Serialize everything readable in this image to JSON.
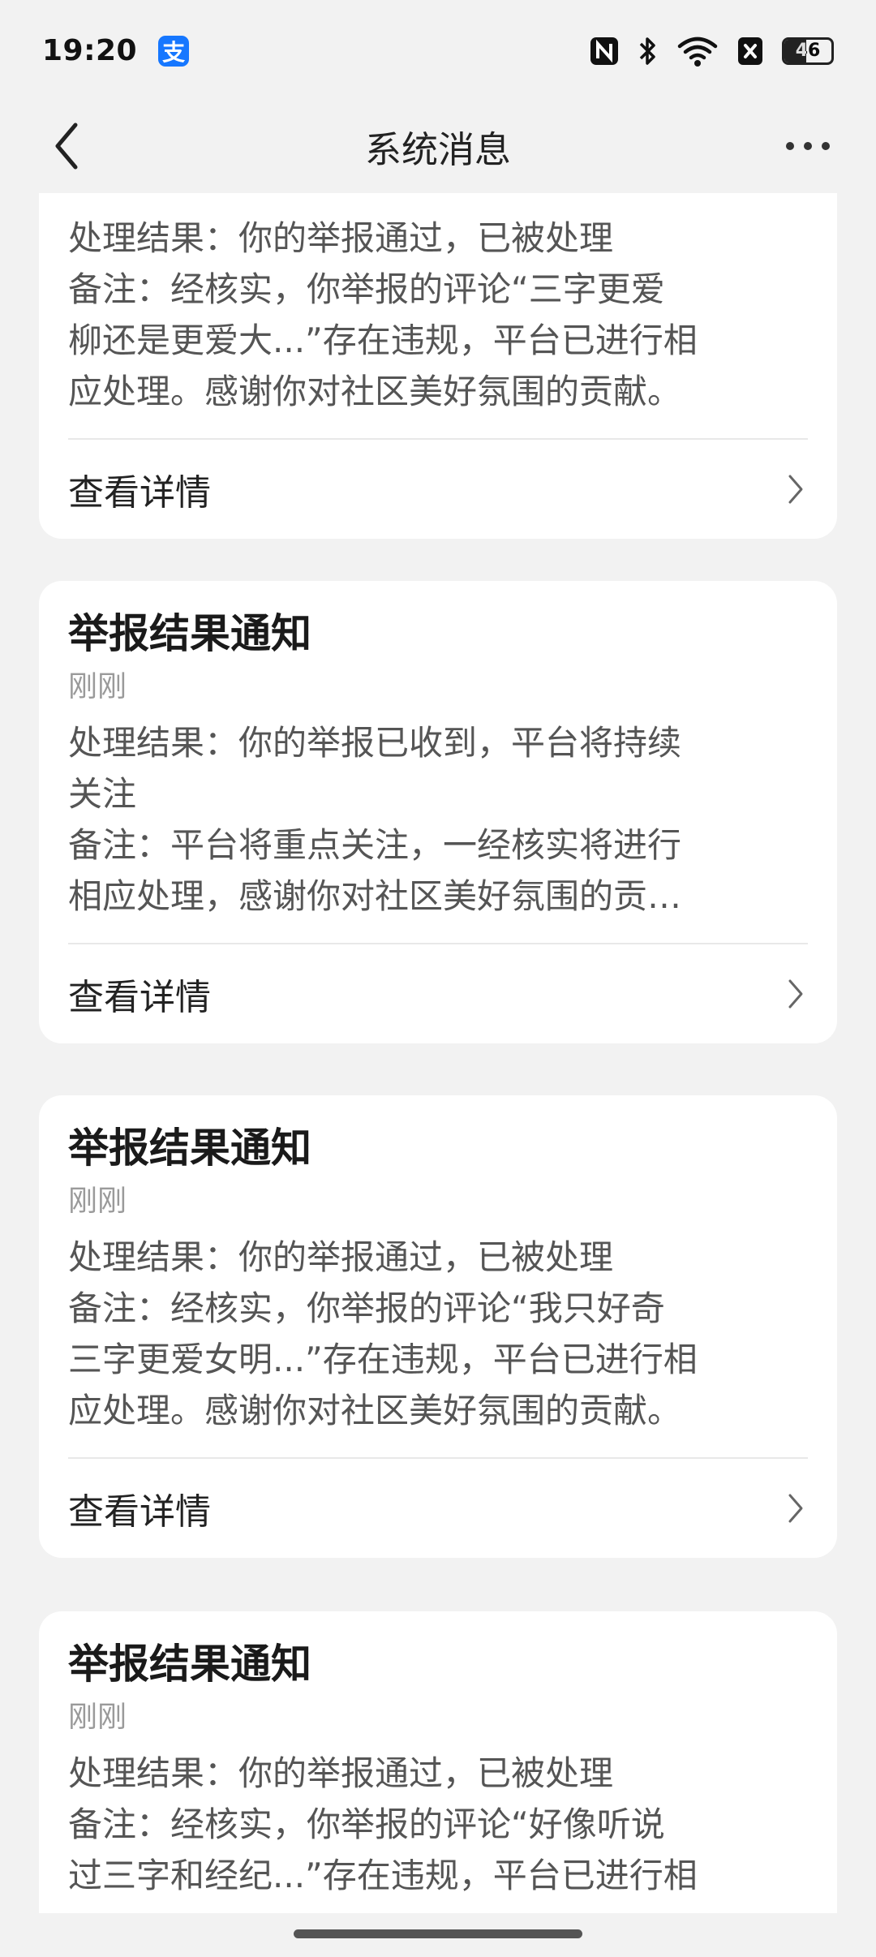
{
  "status_bar": {
    "time": "19:20",
    "app_icon_glyph": "支",
    "battery_level": "46",
    "icons": [
      "alipay-icon",
      "nfc-icon",
      "bluetooth-icon",
      "wifi-icon",
      "sim-icon",
      "battery-icon"
    ]
  },
  "navbar": {
    "title": "系统消息",
    "back_icon": "chevron-left-icon",
    "more_icon": "more-horizontal-icon"
  },
  "cards": [
    {
      "title": "",
      "time": "",
      "body_lines": [
        "处理结果：你的举报通过，已被处理",
        "备注：经核实，你举报的评论“三字更爱",
        "柳还是更爱大...”存在违规，平台已进行相",
        "应处理。感谢你对社区美好氛围的贡献。"
      ],
      "footer_label": "查看详情"
    },
    {
      "title": "举报结果通知",
      "time": "刚刚",
      "body_lines": [
        "处理结果：你的举报已收到，平台将持续",
        "关注",
        "备注：平台将重点关注，一经核实将进行",
        "相应处理，感谢你对社区美好氛围的贡…"
      ],
      "footer_label": "查看详情"
    },
    {
      "title": "举报结果通知",
      "time": "刚刚",
      "body_lines": [
        "处理结果：你的举报通过，已被处理",
        "备注：经核实，你举报的评论“我只好奇",
        "三字更爱女明...”存在违规，平台已进行相",
        "应处理。感谢你对社区美好氛围的贡献。"
      ],
      "footer_label": "查看详情"
    },
    {
      "title": "举报结果通知",
      "time": "刚刚",
      "body_lines": [
        "处理结果：你的举报通过，已被处理",
        "备注：经核实，你举报的评论“好像听说",
        "过三字和经纪...”存在违规，平台已进行相"
      ],
      "footer_label": ""
    }
  ]
}
